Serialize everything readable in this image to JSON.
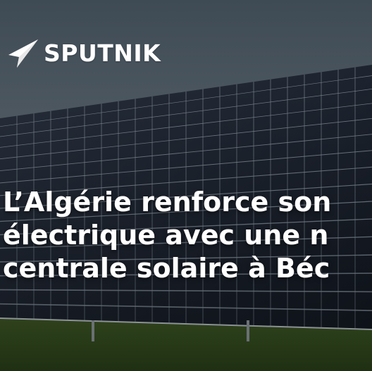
{
  "brand": {
    "name": "SPUTNIK",
    "logo_icon": "sputnik-arrow-logo-icon",
    "text_color": "#ffffff"
  },
  "headline": {
    "lines": [
      "L’Algérie renforce son",
      "électrique avec une n",
      "centrale solaire à Béc"
    ]
  },
  "colors": {
    "sky_top": "#3e4a54",
    "sky_bottom": "#8a959c",
    "panel": "#1c2330",
    "panel_grid": "#8e98a4",
    "grass": "#3f5d28"
  }
}
